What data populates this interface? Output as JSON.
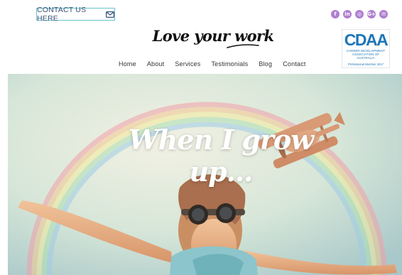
{
  "header": {
    "contact_label": "CONTACT US HERE",
    "socials": [
      {
        "icon": "facebook-icon",
        "glyph": "f"
      },
      {
        "icon": "linkedin-icon",
        "glyph": "in"
      },
      {
        "icon": "instagram-icon",
        "glyph": "◎"
      },
      {
        "icon": "google-plus-icon",
        "glyph": "G+"
      },
      {
        "icon": "email-icon",
        "glyph": "✉"
      }
    ],
    "social_color": "#b07fd0",
    "accent_border": "#69c3cc"
  },
  "logo": {
    "text": "Love your work"
  },
  "badge": {
    "mark": "CDAA",
    "name": "CAREER DEVELOPMENT ASSOCIATION OF AUSTRALIA",
    "member": "Professional Member 2017",
    "color": "#1e76b8"
  },
  "nav": [
    "Home",
    "About",
    "Services",
    "Testimonials",
    "Blog",
    "Contact"
  ],
  "hero": {
    "title": "When I grow up..."
  }
}
